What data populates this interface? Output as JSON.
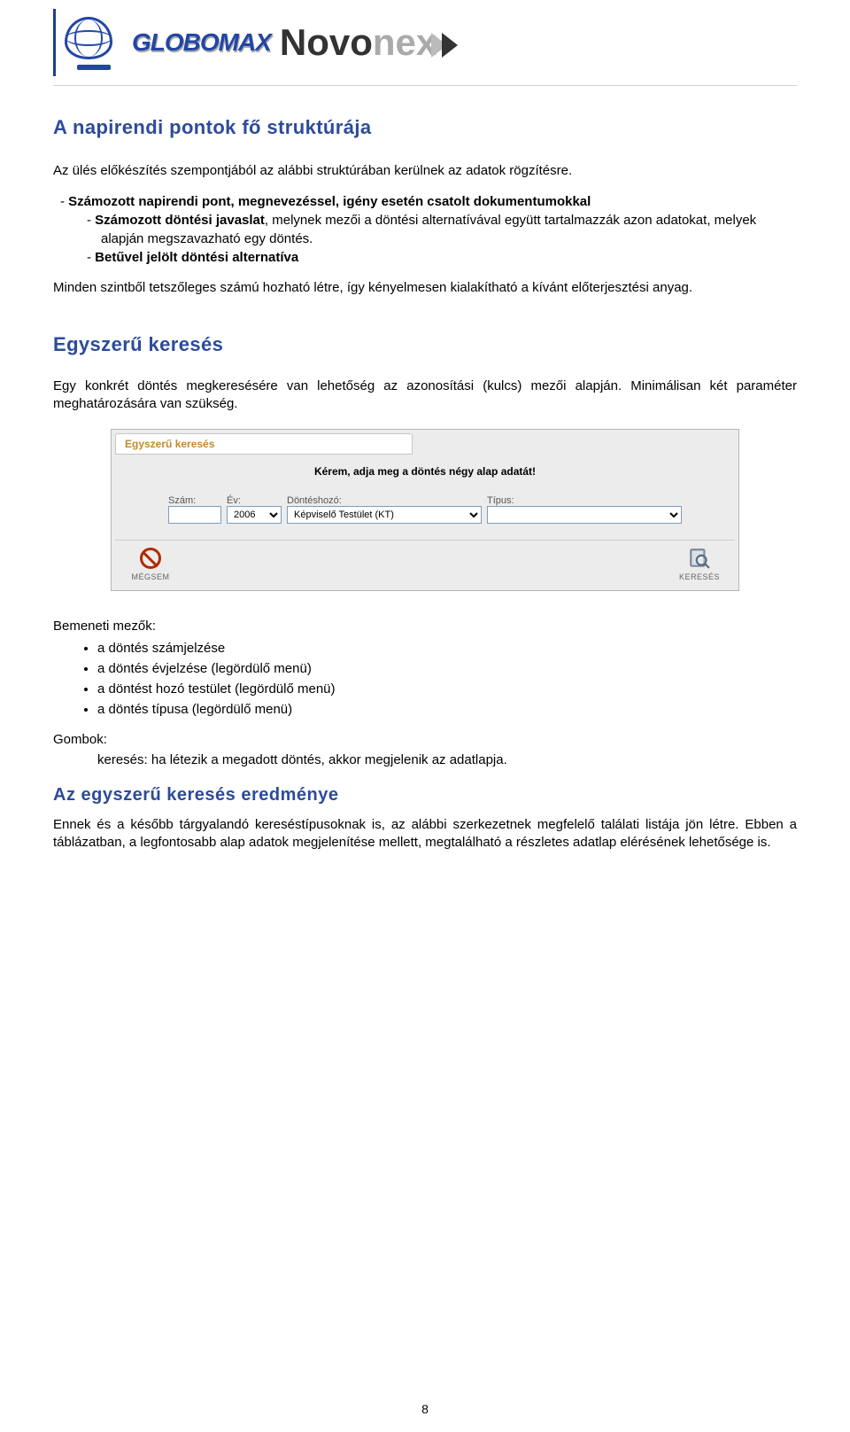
{
  "header": {
    "brand1": "GLOBOMAX",
    "brand2_a": "Novo",
    "brand2_b": "nex"
  },
  "s1": {
    "title": "A napirendi pontok fő struktúrája",
    "intro": "Az ülés előkészítés szempontjából az alábbi struktúrában kerülnek az adatok rögzítésre.",
    "li1": "Számozott napirendi pont, megnevezéssel, igény esetén csatolt dokumentumokkal",
    "li1a": "Számozott döntési javaslat, melynek mezői a döntési alternatívával együtt tartalmazzák azon adatokat, melyek alapján megszavazható egy döntés.",
    "li1b": "Betűvel jelölt döntési alternatíva",
    "para2": "Minden szintből tetszőleges számú hozható létre, így kényelmesen kialakítható a kívánt előterjesztési anyag."
  },
  "s2": {
    "title": "Egyszerű keresés",
    "intro": "Egy konkrét döntés megkeresésére van lehetőség az azonosítási (kulcs) mezői alapján. Minimálisan két paraméter meghatározására van szükség."
  },
  "search": {
    "box_title": "Egyszerű keresés",
    "instruction": "Kérem, adja meg a döntés négy alap adatát!",
    "lbl_szam": "Szám:",
    "lbl_ev": "Év:",
    "val_ev": "2006",
    "lbl_hozo": "Döntéshozó:",
    "val_hozo": "Képviselő Testület (KT)",
    "lbl_tipus": "Típus:",
    "btn_cancel": "MÉGSEM",
    "btn_search": "KERESÉS"
  },
  "s3": {
    "bemeneti_label": "Bemeneti mezők:",
    "b1": "a döntés számjelzése",
    "b2": "a döntés évjelzése (legördülő menü)",
    "b3": "a döntést hozó testület (legördülő menü)",
    "b4": "a döntés típusa (legördülő menü)",
    "gombok_label": "Gombok:",
    "g1": "keresés: ha létezik a megadott döntés, akkor megjelenik az adatlapja.",
    "sub_title": "Az egyszerű keresés eredménye",
    "sub_para": "Ennek és a később tárgyalandó kereséstípusoknak is, az alábbi szerkezetnek megfelelő találati listája jön létre. Ebben a táblázatban, a legfontosabb alap adatok megjelenítése mellett, megtalálható a részletes adatlap elérésének lehetősége is."
  },
  "page_number": "8"
}
